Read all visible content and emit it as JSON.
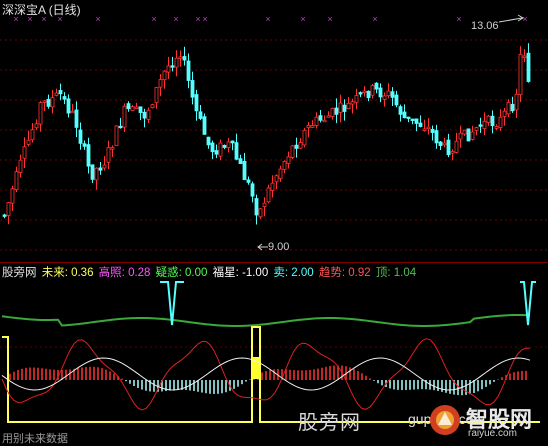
{
  "main_chart": {
    "title": "深深宝A",
    "period": "(日线)",
    "high_label": "13.06",
    "low_label": "9.00",
    "colors": {
      "up": "#ff3232",
      "down": "#54ffff",
      "grid": "#800000",
      "signal": "#c040c0"
    }
  },
  "indicator": {
    "name": "股旁网",
    "fields": [
      {
        "label": "未来:",
        "value": "0.36",
        "color": "#ffff54"
      },
      {
        "label": "高照:",
        "value": "0.28",
        "color": "#ff54ff"
      },
      {
        "label": "疑惑:",
        "value": "0.00",
        "color": "#54ff54"
      },
      {
        "label": "福星:",
        "value": "-1.00",
        "color": "#ffffff"
      },
      {
        "label": "卖:",
        "value": "2.00",
        "color": "#54ffff"
      },
      {
        "label": "趋势:",
        "value": "0.92",
        "color": "#ff5454"
      },
      {
        "label": "顶:",
        "value": "1.04",
        "color": "#54c054"
      }
    ]
  },
  "footer": "用别未来数据",
  "watermark": {
    "text": "股旁网",
    "url": "gupang.com",
    "logo_text": "智股网",
    "logo_url": "raiyue.com"
  }
}
